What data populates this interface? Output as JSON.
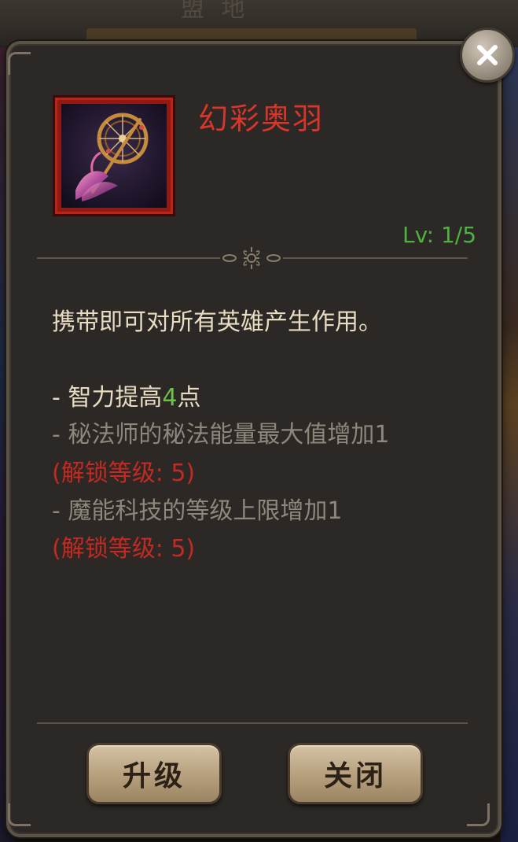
{
  "background": {
    "title": "盟 地"
  },
  "item": {
    "name": "幻彩奥羽",
    "level_text": "Lv: 1/5",
    "icon": "feather-staff-icon"
  },
  "description": {
    "summary": "携带即可对所有英雄产生作用。",
    "bonus_prefix": "- 智力提高",
    "bonus_value": "4",
    "bonus_suffix": "点",
    "effects": [
      {
        "text": "- 秘法师的秘法能量最大值增加1",
        "unlock": "(解锁等级: 5)"
      },
      {
        "text": "- 魔能科技的等级上限增加1",
        "unlock": "(解锁等级: 5)"
      }
    ]
  },
  "buttons": {
    "upgrade": "升级",
    "close": "关闭"
  },
  "colors": {
    "name": "#d9352b",
    "level": "#4fb141",
    "highlight": "#6fc046",
    "locked": "#8e877c",
    "unlock": "#c42a22"
  }
}
